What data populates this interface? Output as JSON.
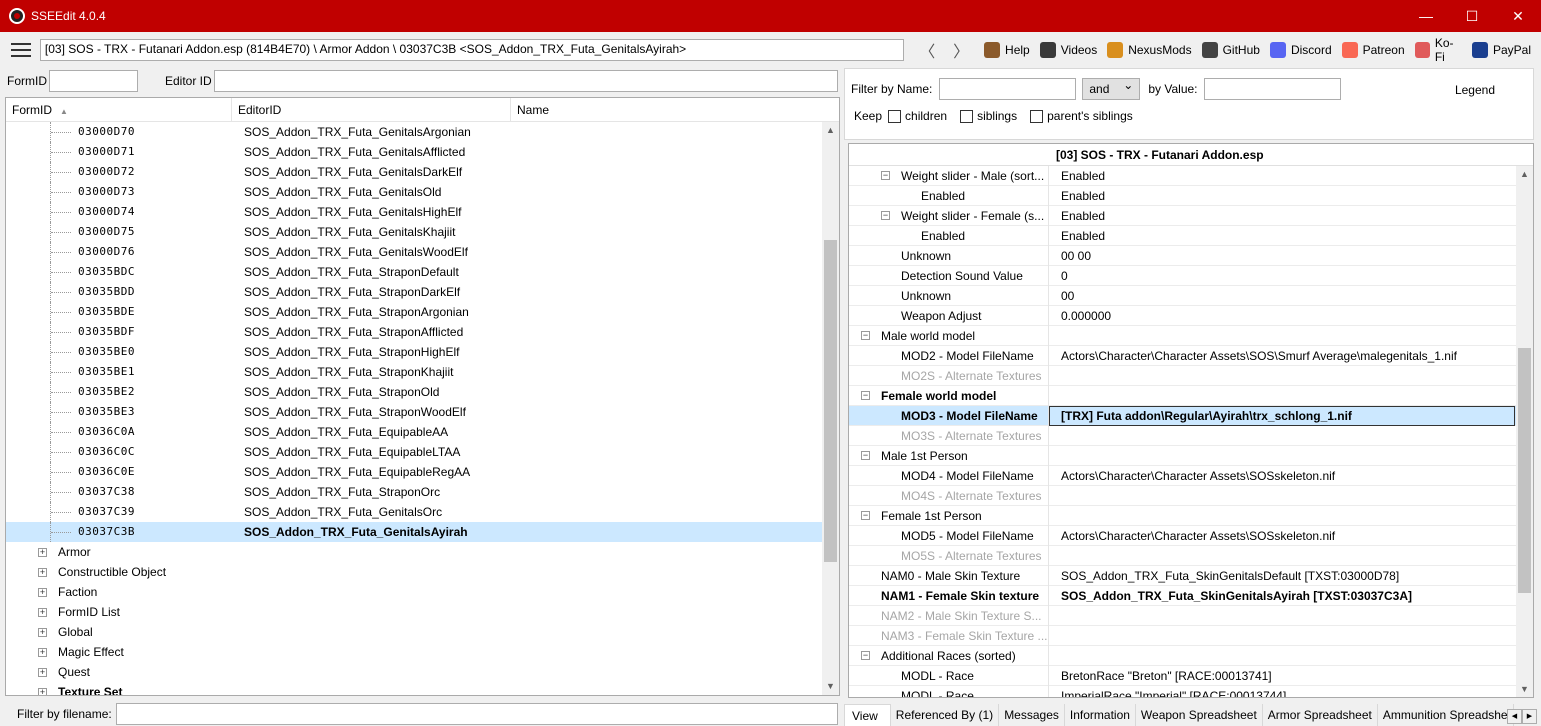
{
  "window": {
    "title": "SSEEdit 4.0.4",
    "minimize": "—",
    "maximize": "☐",
    "close": "✕"
  },
  "toolbar": {
    "path": "[03] SOS - TRX - Futanari Addon.esp (814B4E70) \\ Armor Addon \\ 03037C3B <SOS_Addon_TRX_Futa_GenitalsAyirah>",
    "back": "〈",
    "forward": "〉",
    "links": [
      {
        "label": "Help",
        "icon": "book-icon",
        "color": "#8b5a2b"
      },
      {
        "label": "Videos",
        "icon": "gp-icon",
        "color": "#3a3a3a"
      },
      {
        "label": "NexusMods",
        "icon": "nexus-icon",
        "color": "#d98f1e"
      },
      {
        "label": "GitHub",
        "icon": "github-icon",
        "color": "#444"
      },
      {
        "label": "Discord",
        "icon": "discord-icon",
        "color": "#5865f2"
      },
      {
        "label": "Patreon",
        "icon": "patreon-icon",
        "color": "#f96854"
      },
      {
        "label": "Ko-Fi",
        "icon": "kofi-icon",
        "color": "#e05a5a"
      },
      {
        "label": "PayPal",
        "icon": "paypal-icon",
        "color": "#1b3f8f"
      }
    ]
  },
  "left": {
    "formid_label": "FormID",
    "editorid_label": "Editor ID",
    "columns": [
      "FormID",
      "EditorID",
      "Name"
    ],
    "records": [
      {
        "formid": "03000D70",
        "edid": "SOS_Addon_TRX_Futa_GenitalsArgonian"
      },
      {
        "formid": "03000D71",
        "edid": "SOS_Addon_TRX_Futa_GenitalsAfflicted"
      },
      {
        "formid": "03000D72",
        "edid": "SOS_Addon_TRX_Futa_GenitalsDarkElf"
      },
      {
        "formid": "03000D73",
        "edid": "SOS_Addon_TRX_Futa_GenitalsOld"
      },
      {
        "formid": "03000D74",
        "edid": "SOS_Addon_TRX_Futa_GenitalsHighElf"
      },
      {
        "formid": "03000D75",
        "edid": "SOS_Addon_TRX_Futa_GenitalsKhajiit"
      },
      {
        "formid": "03000D76",
        "edid": "SOS_Addon_TRX_Futa_GenitalsWoodElf"
      },
      {
        "formid": "03035BDC",
        "edid": "SOS_Addon_TRX_Futa_StraponDefault"
      },
      {
        "formid": "03035BDD",
        "edid": "SOS_Addon_TRX_Futa_StraponDarkElf"
      },
      {
        "formid": "03035BDE",
        "edid": "SOS_Addon_TRX_Futa_StraponArgonian"
      },
      {
        "formid": "03035BDF",
        "edid": "SOS_Addon_TRX_Futa_StraponAfflicted"
      },
      {
        "formid": "03035BE0",
        "edid": "SOS_Addon_TRX_Futa_StraponHighElf"
      },
      {
        "formid": "03035BE1",
        "edid": "SOS_Addon_TRX_Futa_StraponKhajiit"
      },
      {
        "formid": "03035BE2",
        "edid": "SOS_Addon_TRX_Futa_StraponOld"
      },
      {
        "formid": "03035BE3",
        "edid": "SOS_Addon_TRX_Futa_StraponWoodElf"
      },
      {
        "formid": "03036C0A",
        "edid": "SOS_Addon_TRX_Futa_EquipableAA"
      },
      {
        "formid": "03036C0C",
        "edid": "SOS_Addon_TRX_Futa_EquipableLTAA"
      },
      {
        "formid": "03036C0E",
        "edid": "SOS_Addon_TRX_Futa_EquipableRegAA"
      },
      {
        "formid": "03037C38",
        "edid": "SOS_Addon_TRX_Futa_StraponOrc"
      },
      {
        "formid": "03037C39",
        "edid": "SOS_Addon_TRX_Futa_GenitalsOrc"
      },
      {
        "formid": "03037C3B",
        "edid": "SOS_Addon_TRX_Futa_GenitalsAyirah"
      }
    ],
    "groups": [
      "Armor",
      "Constructible Object",
      "Faction",
      "FormID List",
      "Global",
      "Magic Effect",
      "Quest",
      "Texture Set"
    ],
    "filename_label": "Filter by filename:"
  },
  "right": {
    "filter_name_label": "Filter by Name:",
    "and_label": "and",
    "by_value_label": "by Value:",
    "legend": "Legend",
    "keep_label": "Keep",
    "children": "children",
    "siblings": "siblings",
    "parent_siblings": "parent's siblings",
    "plugin": "[03] SOS - TRX - Futanari Addon.esp",
    "rows": [
      {
        "k": "Weight slider - Male (sort...",
        "v": "Enabled",
        "indent": 1,
        "toggle": true
      },
      {
        "k": "Enabled",
        "v": "Enabled",
        "indent": 2
      },
      {
        "k": "Weight slider - Female (s...",
        "v": "Enabled",
        "indent": 1,
        "toggle": true
      },
      {
        "k": "Enabled",
        "v": "Enabled",
        "indent": 2
      },
      {
        "k": "Unknown",
        "v": "00 00",
        "indent": 1
      },
      {
        "k": "Detection Sound Value",
        "v": "0",
        "indent": 1
      },
      {
        "k": "Unknown",
        "v": "00",
        "indent": 1
      },
      {
        "k": "Weapon Adjust",
        "v": "0.000000",
        "indent": 1
      },
      {
        "k": "Male world model",
        "v": "",
        "indent": 0,
        "toggle": true
      },
      {
        "k": "MOD2 - Model FileName",
        "v": "Actors\\Character\\Character Assets\\SOS\\Smurf Average\\malegenitals_1.nif",
        "indent": 1
      },
      {
        "k": "MO2S - Alternate Textures",
        "v": "",
        "indent": 1,
        "gray": true
      },
      {
        "k": "Female world model",
        "v": "",
        "indent": 0,
        "toggle": true,
        "bold": true
      },
      {
        "k": "MOD3 - Model FileName",
        "v": "[TRX] Futa addon\\Regular\\Ayirah\\trx_schlong_1.nif",
        "indent": 1,
        "bold": true,
        "sel": true
      },
      {
        "k": "MO3S - Alternate Textures",
        "v": "",
        "indent": 1,
        "gray": true
      },
      {
        "k": "Male 1st Person",
        "v": "",
        "indent": 0,
        "toggle": true
      },
      {
        "k": "MOD4 - Model FileName",
        "v": "Actors\\Character\\Character Assets\\SOSskeleton.nif",
        "indent": 1
      },
      {
        "k": "MO4S - Alternate Textures",
        "v": "",
        "indent": 1,
        "gray": true
      },
      {
        "k": "Female 1st Person",
        "v": "",
        "indent": 0,
        "toggle": true
      },
      {
        "k": "MOD5 - Model FileName",
        "v": "Actors\\Character\\Character Assets\\SOSskeleton.nif",
        "indent": 1
      },
      {
        "k": "MO5S - Alternate Textures",
        "v": "",
        "indent": 1,
        "gray": true
      },
      {
        "k": "NAM0 - Male Skin Texture",
        "v": "SOS_Addon_TRX_Futa_SkinGenitalsDefault [TXST:03000D78]",
        "indent": 0
      },
      {
        "k": "NAM1 - Female Skin texture",
        "v": "SOS_Addon_TRX_Futa_SkinGenitalsAyirah [TXST:03037C3A]",
        "indent": 0,
        "bold": true
      },
      {
        "k": "NAM2 - Male Skin Texture S...",
        "v": "",
        "indent": 0,
        "gray": true
      },
      {
        "k": "NAM3 - Female Skin Texture ...",
        "v": "",
        "indent": 0,
        "gray": true
      },
      {
        "k": "Additional Races (sorted)",
        "v": "",
        "indent": 0,
        "toggle": true
      },
      {
        "k": "MODL - Race",
        "v": "BretonRace \"Breton\" [RACE:00013741]",
        "indent": 1
      },
      {
        "k": "MODL - Race",
        "v": "ImperialRace \"Imperial\" [RACE:00013744]",
        "indent": 1
      }
    ],
    "tabs": [
      "View",
      "Referenced By (1)",
      "Messages",
      "Information",
      "Weapon Spreadsheet",
      "Armor Spreadsheet",
      "Ammunition Spreadshe"
    ]
  }
}
